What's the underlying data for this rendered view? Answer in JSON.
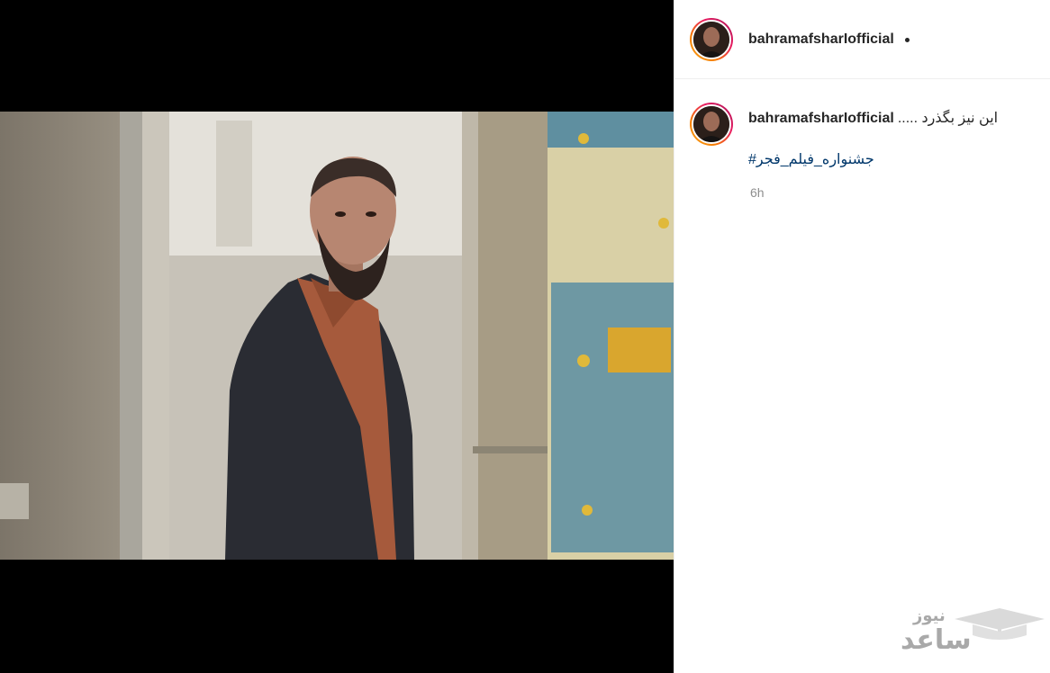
{
  "post": {
    "username": "bahramafsharIofficial",
    "caption_text": "..... این نیز بگذرد",
    "hashtag": "#جشنواره_فیلم_فجر",
    "time_ago": "6h"
  },
  "media": {
    "alt": "photo of a bearded man in a dark jacket standing in a doorway"
  },
  "watermark": {
    "main": "ساعد",
    "sub": "نیوز"
  }
}
